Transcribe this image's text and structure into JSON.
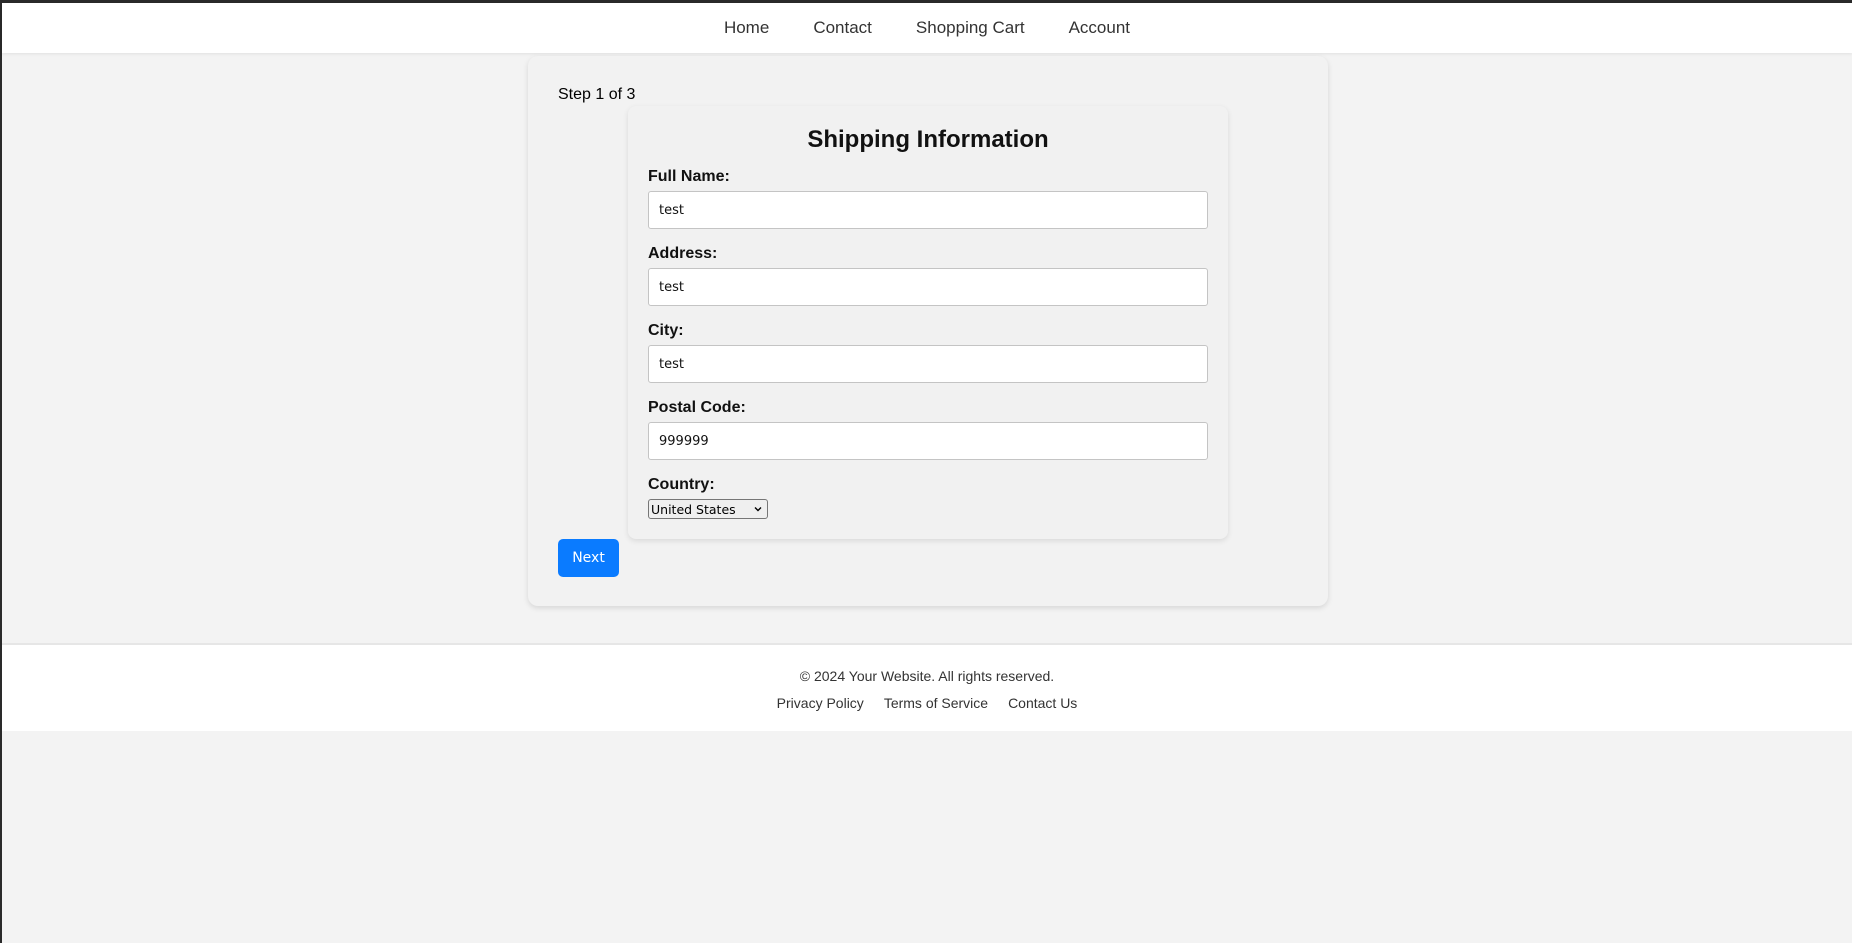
{
  "nav": {
    "items": [
      {
        "label": "Home"
      },
      {
        "label": "Contact"
      },
      {
        "label": "Shopping Cart"
      },
      {
        "label": "Account"
      }
    ]
  },
  "checkout": {
    "step_text": "Step 1 of 3",
    "form": {
      "title": "Shipping Information",
      "fields": [
        {
          "label": "Full Name:",
          "value": "test"
        },
        {
          "label": "Address:",
          "value": "test"
        },
        {
          "label": "City:",
          "value": "test"
        },
        {
          "label": "Postal Code:",
          "value": "999999"
        }
      ],
      "country": {
        "label": "Country:",
        "selected": "United States"
      }
    },
    "next_label": "Next",
    "accent_color": "#0a7bff"
  },
  "footer": {
    "copyright": "© 2024 Your Website. All rights reserved.",
    "links": [
      {
        "label": "Privacy Policy"
      },
      {
        "label": "Terms of Service"
      },
      {
        "label": "Contact Us"
      }
    ]
  }
}
